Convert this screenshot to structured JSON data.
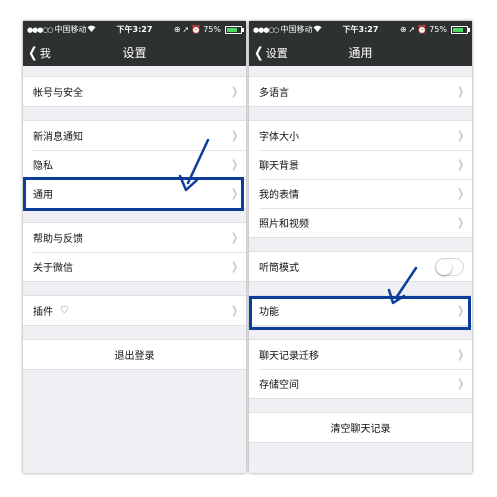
{
  "status_bar": {
    "carrier": "中国移动",
    "time": "下午3:27",
    "battery": "75%",
    "battery_level": 0.75
  },
  "left_screen": {
    "back_label": "我",
    "title": "设置",
    "groups": [
      [
        "帐号与安全"
      ],
      [
        "新消息通知",
        "隐私",
        "通用"
      ],
      [
        "帮助与反馈",
        "关于微信"
      ],
      [
        "插件"
      ]
    ],
    "logout": "退出登录"
  },
  "right_screen": {
    "back_label": "设置",
    "title": "通用",
    "groups": [
      [
        "多语言"
      ],
      [
        "字体大小",
        "聊天背景",
        "我的表情",
        "照片和视频"
      ],
      [
        "听筒模式"
      ],
      [
        "功能"
      ],
      [
        "聊天记录迁移",
        "存储空间"
      ]
    ],
    "clear_chat": "清空聊天记录",
    "earpiece_mode_on": false
  },
  "colors": {
    "nav_background": "#2e3132",
    "highlight": "#0b3d9a",
    "battery": "#4cd964"
  }
}
